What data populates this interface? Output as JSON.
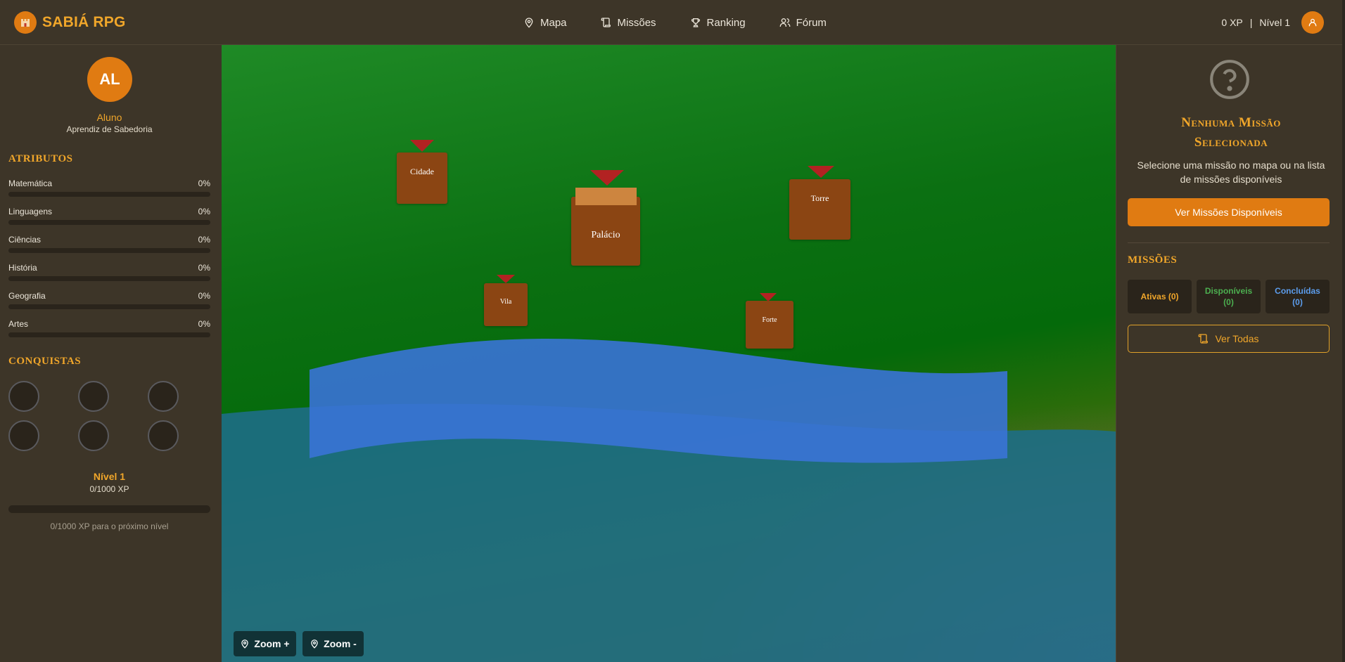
{
  "header": {
    "brand": "SABIÁ RPG",
    "nav": [
      {
        "label": "Mapa",
        "icon": "map-pin-icon"
      },
      {
        "label": "Missões",
        "icon": "scroll-icon"
      },
      {
        "label": "Ranking",
        "icon": "trophy-icon"
      },
      {
        "label": "Fórum",
        "icon": "users-icon"
      }
    ],
    "xp": "0 XP",
    "separator": "|",
    "level": "Nível 1"
  },
  "profile": {
    "initials": "AL",
    "name": "Aluno",
    "title": "Aprendiz de Sabedoria"
  },
  "attributes": {
    "title": "ATRIBUTOS",
    "items": [
      {
        "name": "Matemática",
        "value": "0%"
      },
      {
        "name": "Linguagens",
        "value": "0%"
      },
      {
        "name": "Ciências",
        "value": "0%"
      },
      {
        "name": "História",
        "value": "0%"
      },
      {
        "name": "Geografia",
        "value": "0%"
      },
      {
        "name": "Artes",
        "value": "0%"
      }
    ]
  },
  "achievements": {
    "title": "CONQUISTAS",
    "slots": 6
  },
  "progress": {
    "level": "Nível 1",
    "xp": "0/1000 XP",
    "fraction": 0,
    "next": "0/1000 XP para o próximo nível"
  },
  "map": {
    "locations": [
      {
        "name": "Cidade"
      },
      {
        "name": "Palácio"
      },
      {
        "name": "Torre"
      },
      {
        "name": "Vila"
      },
      {
        "name": "Forte"
      }
    ],
    "zoom_in": "Zoom +",
    "zoom_out": "Zoom -"
  },
  "mission_panel": {
    "empty_title_line1": "Nenhuma Missão",
    "empty_title_line2": "Selecionada",
    "empty_desc": "Selecione uma missão no mapa ou na lista de missões disponíveis",
    "view_available": "Ver Missões Disponíveis",
    "missions_title": "MISSÕES",
    "stats": [
      {
        "label": "Ativas (0)",
        "color": "#f0a62a"
      },
      {
        "label": "Disponíveis",
        "count": "(0)",
        "color": "#4caf50"
      },
      {
        "label": "Concluídas",
        "count": "(0)",
        "color": "#5c9ded"
      }
    ],
    "view_all": "Ver Todas"
  },
  "colors": {
    "accent": "#e07b12",
    "gold": "#f0a62a",
    "marker": "#b22222",
    "building": "#8b4513"
  }
}
